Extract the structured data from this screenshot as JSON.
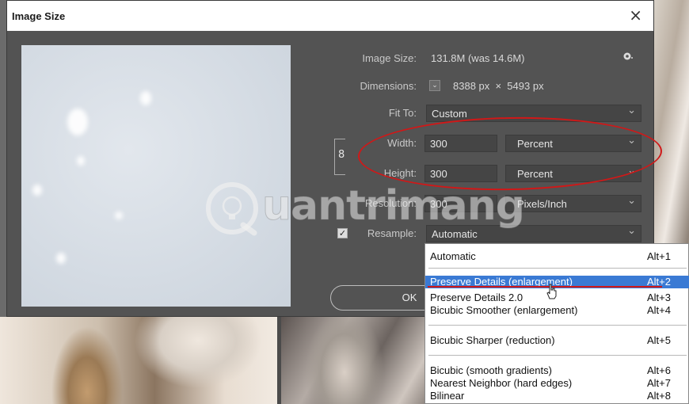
{
  "dialog": {
    "title": "Image Size",
    "close": "×",
    "image_size_label": "Image Size:",
    "image_size_value": "131.8M (was 14.6M)",
    "dimensions_label": "Dimensions:",
    "dimensions_value": "8388 px  ×  5493 px",
    "fit_to_label": "Fit To:",
    "fit_to_value": "Custom",
    "width_label": "Width:",
    "width_value": "300",
    "width_unit": "Percent",
    "height_label": "Height:",
    "height_value": "300",
    "height_unit": "Percent",
    "resolution_label": "Resolution:",
    "resolution_value": "300",
    "resolution_unit": "Pixels/Inch",
    "resample_label": "Resample:",
    "resample_value": "Automatic",
    "ok_label": "OK"
  },
  "resample_menu": {
    "items": [
      {
        "label": "Automatic",
        "shortcut": "Alt+1"
      },
      {
        "label": "Preserve Details (enlargement)",
        "shortcut": "Alt+2",
        "selected": true
      },
      {
        "label": "Preserve Details 2.0",
        "shortcut": "Alt+3"
      },
      {
        "label": "Bicubic Smoother (enlargement)",
        "shortcut": "Alt+4"
      },
      {
        "label": "Bicubic Sharper (reduction)",
        "shortcut": "Alt+5"
      },
      {
        "label": "Bicubic (smooth gradients)",
        "shortcut": "Alt+6"
      },
      {
        "label": "Nearest Neighbor (hard edges)",
        "shortcut": "Alt+7"
      },
      {
        "label": "Bilinear",
        "shortcut": "Alt+8"
      }
    ]
  },
  "watermark": {
    "text": "uantrimang"
  },
  "colors": {
    "dialog_bg": "#535353",
    "highlight": "#3a7ad4",
    "annotation_red": "#d01818"
  }
}
